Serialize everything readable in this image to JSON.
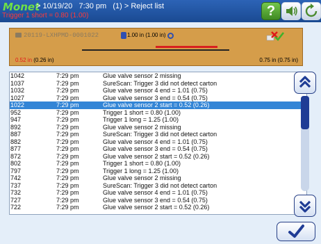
{
  "header": {
    "brand": "Monet",
    "breadcrumb": "> 10/19/20   7:30 pm   (1) > Reject list",
    "subtitle": "Trigger 1 short = 0.80 (1.00)",
    "help_label": "?"
  },
  "panel": {
    "product_id": "20119-LXHPMD-0001022",
    "center_value": "1.00 in (1.00 in)",
    "left_value": "0.52 in",
    "left_ref": " (0.26 in)",
    "right_value": "0.75 in (0.75 in)",
    "left_value_color": "#e21a1a",
    "bar_color": "#d59d4a"
  },
  "list": {
    "selected_index": 4,
    "selection_color": "#3385d6",
    "rows": [
      {
        "id": "1042",
        "time": "7:29 pm",
        "message": "Glue valve sensor 2 missing"
      },
      {
        "id": "1037",
        "time": "7:29 pm",
        "message": "SureScan: Trigger 3 did not detect carton"
      },
      {
        "id": "1032",
        "time": "7:29 pm",
        "message": "Glue valve sensor 4 end = 1.01 (0.75)"
      },
      {
        "id": "1027",
        "time": "7:29 pm",
        "message": "Glue valve sensor 3 end = 0.54 (0.75)"
      },
      {
        "id": "1022",
        "time": "7:29 pm",
        "message": "Glue valve sensor 2 start = 0.52 (0.26)"
      },
      {
        "id": "952",
        "time": "7:29 pm",
        "message": "Trigger 1 short = 0.80 (1.00)"
      },
      {
        "id": "947",
        "time": "7:29 pm",
        "message": "Trigger 1 long = 1.25 (1.00)"
      },
      {
        "id": "892",
        "time": "7:29 pm",
        "message": "Glue valve sensor 2 missing"
      },
      {
        "id": "887",
        "time": "7:29 pm",
        "message": "SureScan: Trigger 3 did not detect carton"
      },
      {
        "id": "882",
        "time": "7:29 pm",
        "message": "Glue valve sensor 4 end = 1.01 (0.75)"
      },
      {
        "id": "877",
        "time": "7:29 pm",
        "message": "Glue valve sensor 3 end = 0.54 (0.75)"
      },
      {
        "id": "872",
        "time": "7:29 pm",
        "message": "Glue valve sensor 2 start = 0.52 (0.26)"
      },
      {
        "id": "802",
        "time": "7:29 pm",
        "message": "Trigger 1 short = 0.80 (1.00)"
      },
      {
        "id": "797",
        "time": "7:29 pm",
        "message": "Trigger 1 long = 1.25 (1.00)"
      },
      {
        "id": "742",
        "time": "7:29 pm",
        "message": "Glue valve sensor 2 missing"
      },
      {
        "id": "737",
        "time": "7:29 pm",
        "message": "SureScan: Trigger 3 did not detect carton"
      },
      {
        "id": "732",
        "time": "7:29 pm",
        "message": "Glue valve sensor 4 end = 1.01 (0.75)"
      },
      {
        "id": "727",
        "time": "7:29 pm",
        "message": "Glue valve sensor 3 end = 0.54 (0.75)"
      },
      {
        "id": "722",
        "time": "7:29 pm",
        "message": "Glue valve sensor 2 start = 0.52 (0.26)"
      }
    ]
  },
  "scroll": {
    "up_icon": "double-chevron-up-icon",
    "down_icon": "double-chevron-down-icon"
  },
  "ok": {
    "icon": "checkmark-icon"
  }
}
